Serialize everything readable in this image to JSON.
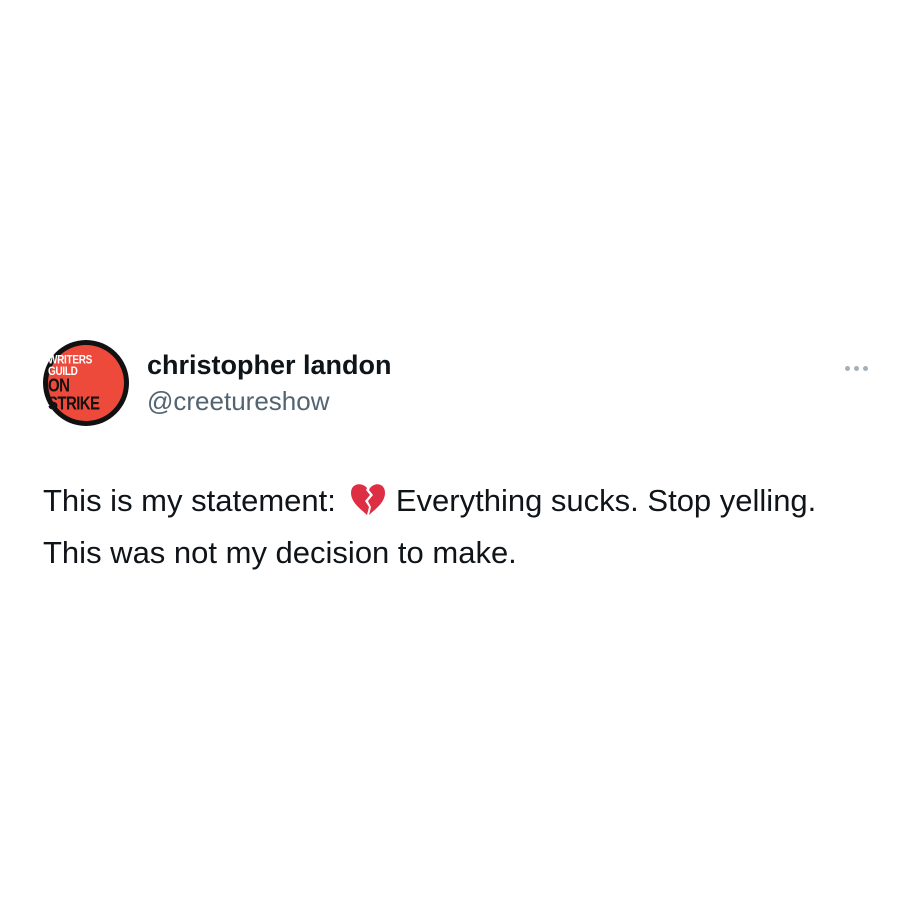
{
  "tweet": {
    "author": {
      "display_name": "christopher landon",
      "handle": "@creetureshow",
      "avatar": {
        "line1": "WRITERS GUILD",
        "line2": "ON STRIKE",
        "background_color": "#ee4a3c"
      }
    },
    "more_icon": "more-horizontal-icon",
    "text": {
      "line1_before_emoji": "This is my statement:",
      "emoji": "broken-heart-emoji",
      "line1_after_emoji": "Everything sucks. Stop yelling.",
      "line2": "This was not my decision to make."
    }
  }
}
